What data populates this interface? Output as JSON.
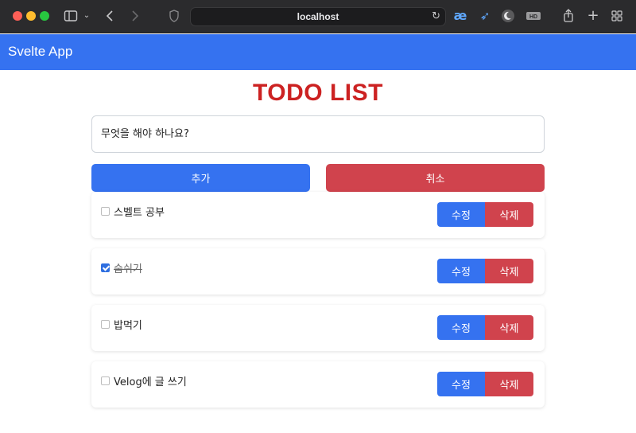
{
  "browser": {
    "url": "localhost"
  },
  "app": {
    "title": "Svelte App",
    "heading": "TODO LIST"
  },
  "form": {
    "input_placeholder": "무엇을 해야 하나요?",
    "add_label": "추가",
    "cancel_label": "취소"
  },
  "todos": [
    {
      "text": "스벨트 공부",
      "done": false,
      "edit_label": "수정",
      "delete_label": "삭제"
    },
    {
      "text": "숨쉬기",
      "done": true,
      "edit_label": "수정",
      "delete_label": "삭제"
    },
    {
      "text": "밥먹기",
      "done": false,
      "edit_label": "수정",
      "delete_label": "삭제"
    },
    {
      "text": "Velog에 글 쓰기",
      "done": false,
      "edit_label": "수정",
      "delete_label": "삭제"
    }
  ],
  "colors": {
    "primary": "#3572f0",
    "danger": "#d0434d",
    "heading": "#cc2222"
  }
}
